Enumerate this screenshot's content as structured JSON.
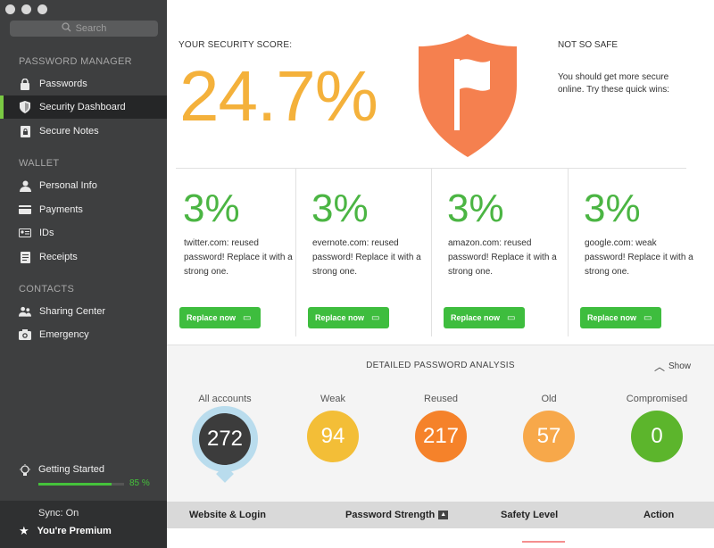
{
  "sidebar": {
    "search_placeholder": "Search",
    "section_password_manager": "PASSWORD MANAGER",
    "section_wallet": "WALLET",
    "section_contacts": "CONTACTS",
    "items": [
      {
        "label": "Passwords",
        "icon": "lock-icon"
      },
      {
        "label": "Security Dashboard",
        "icon": "shield-icon"
      },
      {
        "label": "Secure Notes",
        "icon": "note-icon"
      },
      {
        "label": "Personal Info",
        "icon": "person-icon"
      },
      {
        "label": "Payments",
        "icon": "card-icon"
      },
      {
        "label": "IDs",
        "icon": "id-icon"
      },
      {
        "label": "Receipts",
        "icon": "receipt-icon"
      },
      {
        "label": "Sharing Center",
        "icon": "sharing-icon"
      },
      {
        "label": "Emergency",
        "icon": "camera-icon"
      }
    ],
    "getting_started": {
      "label": "Getting Started",
      "percent_text": "85 %",
      "progress": 0.85
    },
    "sync": "Sync: On",
    "premium": "You're Premium"
  },
  "score": {
    "label": "YOUR SECURITY SCORE:",
    "value": "24.7%",
    "status_title": "NOT SO SAFE",
    "status_text": "You should get more secure online. Try these quick wins:"
  },
  "quick_wins": [
    {
      "pct": "3%",
      "desc": "twitter.com: reused password! Replace it with a strong one.",
      "button": "Replace now"
    },
    {
      "pct": "3%",
      "desc": "evernote.com: reused password! Replace it with a strong one.",
      "button": "Replace now"
    },
    {
      "pct": "3%",
      "desc": "amazon.com: reused password! Replace it with a strong one.",
      "button": "Replace now"
    },
    {
      "pct": "3%",
      "desc": "google.com: weak password! Replace it with a strong one.",
      "button": "Replace now"
    }
  ],
  "analysis": {
    "title": "DETAILED PASSWORD ANALYSIS",
    "show": "Show",
    "stats": [
      {
        "label": "All accounts",
        "value": "272",
        "color": "#3c3c3c"
      },
      {
        "label": "Weak",
        "value": "94",
        "color": "#f3be37"
      },
      {
        "label": "Reused",
        "value": "217",
        "color": "#f5822a"
      },
      {
        "label": "Old",
        "value": "57",
        "color": "#f7a84a"
      },
      {
        "label": "Compromised",
        "value": "0",
        "color": "#5cb52c"
      }
    ]
  },
  "table": {
    "col_website": "Website & Login",
    "col_strength": "Password Strength",
    "col_safety": "Safety Level",
    "col_action": "Action"
  },
  "colors": {
    "accent_green": "#3ebd3e",
    "score_orange": "#f4b13b",
    "shield_orange": "#f5804f"
  }
}
